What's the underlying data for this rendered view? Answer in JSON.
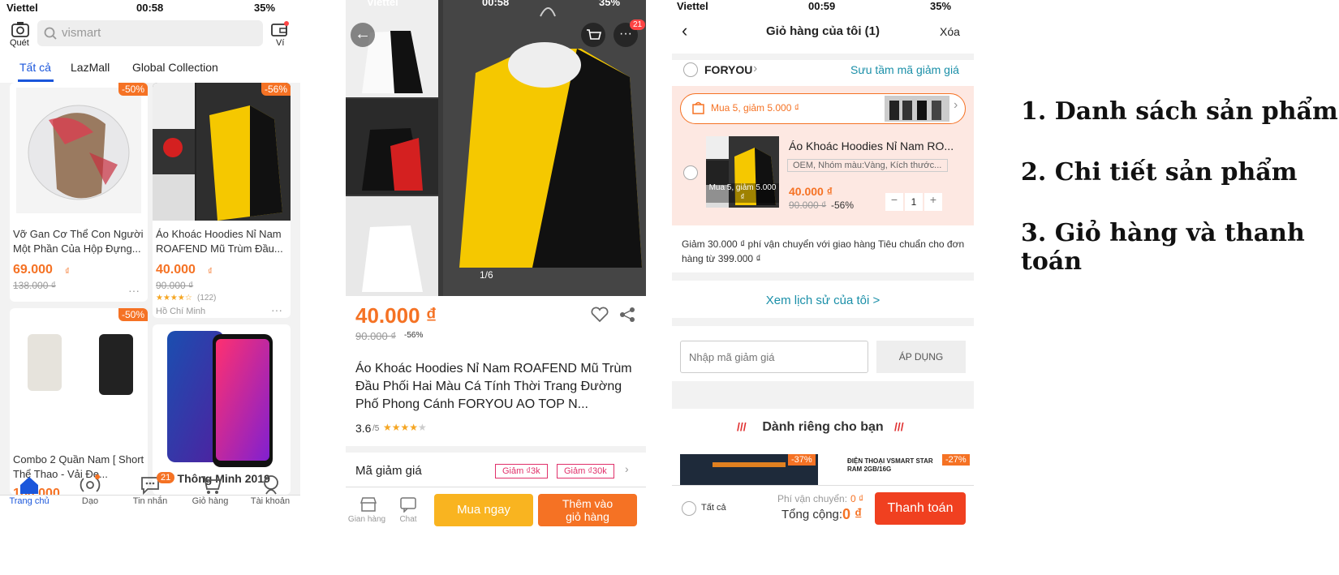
{
  "status": {
    "carrier": "Viettel",
    "time1": "00:58",
    "time2": "00:58",
    "time3": "00:59",
    "battery": "35%"
  },
  "home": {
    "scan_label": "Quét",
    "search_placeholder": "vismart",
    "wallet_label": "Ví",
    "tabs": [
      "Tất cả",
      "LazMall",
      "Global Collection"
    ],
    "products": [
      {
        "discount": "-50%",
        "name": "Vỡ Gan Cơ Thể Con Người Một Phần Của Hộp Đựng...",
        "price": "69.000",
        "currency": "₫",
        "old_price": "138.000 ₫"
      },
      {
        "discount": "-56%",
        "name": "Áo Khoác Hoodies Nỉ Nam ROAFEND Mũ Trùm Đầu...",
        "price": "40.000",
        "currency": "₫",
        "old_price": "90.000 ₫",
        "rating_count": "(122)",
        "location": "Hồ Chí Minh"
      },
      {
        "discount": "-50%",
        "name": "Combo 2 Quần Nam [ Short Thể Thao - Vải Đẹ...",
        "price": "160.000",
        "currency": "₫"
      },
      {
        "name": "ĐT Thông Minh 2019"
      }
    ],
    "nav": [
      "Trang chủ",
      "Dạo",
      "Tin nhắn",
      "Giỏ hàng",
      "Tài khoản"
    ],
    "msg_badge": "21"
  },
  "detail": {
    "cart_badge": "21",
    "image_counter": "1/6",
    "price": "40.000 ₫",
    "old_price": "90.000 ₫",
    "discount": "-56%",
    "title": "Áo Khoác Hoodies Nỉ Nam ROAFEND Mũ Trùm Đầu Phối Hai Màu Cá Tính Thời Trang Đường Phố Phong Cánh FORYOU AO TOP N...",
    "rating": "3.6",
    "rating_of": "/5",
    "voucher_label": "Mã giảm giá",
    "vouchers": [
      "Giảm ₫3k",
      "Giảm ₫30k"
    ],
    "shop_label": "Gian hàng",
    "chat_label": "Chat",
    "buy_now": "Mua ngay",
    "add_to_cart": "Thêm vào giỏ hàng"
  },
  "cart": {
    "title": "Giỏ hàng của tôi (1)",
    "delete": "Xóa",
    "shop": "FORYOU",
    "collect_voucher": "Sưu tầm mã giảm giá",
    "promo": "Mua 5, giảm 5.000 ₫",
    "item_name": "Áo Khoác Hoodies Nỉ Nam RO...",
    "item_variant": "OEM, Nhóm màu:Vàng, Kích thước...",
    "item_promo_tag": "Mua 5, giảm 5.000 ₫",
    "item_price": "40.000 ₫",
    "item_old_price": "90.000 ₫",
    "item_discount": "-56%",
    "qty": "1",
    "shipping_note": "Giảm 30.000 ₫ phí vận chuyển với giao hàng Tiêu chuẩn cho đơn hàng từ 399.000 ₫",
    "history_link": "Xem lịch sử của tôi  >",
    "voucher_placeholder": "Nhập mã giảm giá",
    "apply": "ÁP DỤNG",
    "for_you": "Dành riêng cho bạn",
    "rec_discounts": [
      "-37%",
      "-27%"
    ],
    "rec_text": "ĐIỆN THOẠI VSMART STAR RAM 2GB/16G",
    "select_all": "Tất cả",
    "shipping_fee_label": "Phí vận chuyển:",
    "shipping_fee": "0 ₫",
    "total_label": "Tổng cộng:",
    "total": "0 ₫",
    "checkout": "Thanh toán"
  },
  "captions": [
    "1. Danh sách sản phẩm",
    "2. Chi tiết sản phẩm",
    "3. Giỏ hàng và thanh toán"
  ],
  "colors": {
    "accent": "#f57224",
    "blue": "#1a56db",
    "teal": "#1a8fa8"
  }
}
